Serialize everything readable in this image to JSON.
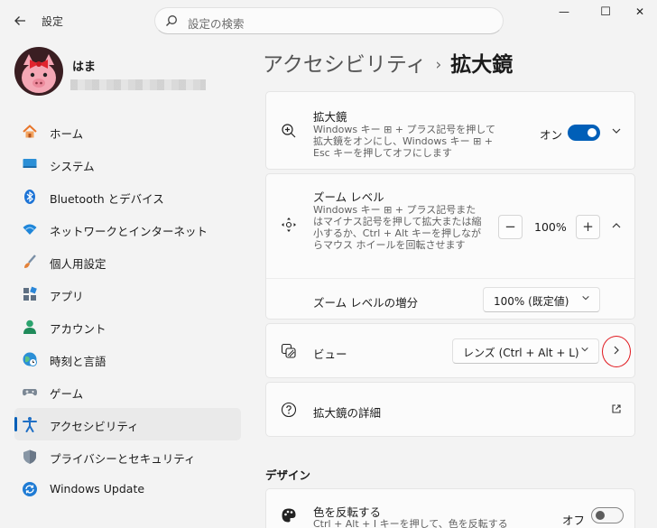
{
  "titlebar": {
    "back_icon": "back-arrow-icon",
    "app_title": "設定",
    "search_placeholder": "設定の検索",
    "minimize": "—",
    "maximize": "☐",
    "close": "✕"
  },
  "profile": {
    "name": "はま"
  },
  "sidebar": {
    "items": [
      {
        "label": "ホーム",
        "icon": "home-icon"
      },
      {
        "label": "システム",
        "icon": "system-icon"
      },
      {
        "label": "Bluetooth とデバイス",
        "icon": "bluetooth-icon"
      },
      {
        "label": "ネットワークとインターネット",
        "icon": "wifi-icon"
      },
      {
        "label": "個人用設定",
        "icon": "brush-icon"
      },
      {
        "label": "アプリ",
        "icon": "apps-icon"
      },
      {
        "label": "アカウント",
        "icon": "account-icon"
      },
      {
        "label": "時刻と言語",
        "icon": "globe-clock-icon"
      },
      {
        "label": "ゲーム",
        "icon": "gamepad-icon"
      },
      {
        "label": "アクセシビリティ",
        "icon": "accessibility-icon",
        "active": true
      },
      {
        "label": "プライバシーとセキュリティ",
        "icon": "shield-icon"
      },
      {
        "label": "Windows Update",
        "icon": "update-icon"
      }
    ]
  },
  "breadcrumb": {
    "parent": "アクセシビリティ",
    "separator": "›",
    "current": "拡大鏡"
  },
  "magnifier": {
    "title": "拡大鏡",
    "desc": "Windows キー ⊞ + プラス記号を押して拡大鏡をオンにし、Windows キー ⊞ + Esc キーを押してオフにします",
    "state_label": "オン",
    "enabled": true
  },
  "zoom": {
    "title": "ズーム レベル",
    "desc": "Windows キー ⊞ + プラス記号またはマイナス記号を押して拡大または縮小するか、Ctrl + Alt キーを押しながらマウス ホイールを回転させます",
    "value": "100%",
    "minus": "−",
    "plus": "+",
    "increment_label": "ズーム レベルの増分",
    "increment_value": "100% (既定値)"
  },
  "view": {
    "title": "ビュー",
    "value": "レンズ (Ctrl + Alt + L)"
  },
  "details": {
    "title": "拡大鏡の詳細"
  },
  "design": {
    "section_title": "デザイン",
    "invert_title": "色を反転する",
    "invert_desc": "Ctrl + Alt + I キーを押して、色を反転する",
    "invert_state": "オフ",
    "invert_enabled": false
  },
  "colors": {
    "accent": "#005fb8",
    "highlight_circle": "#e0191f"
  }
}
